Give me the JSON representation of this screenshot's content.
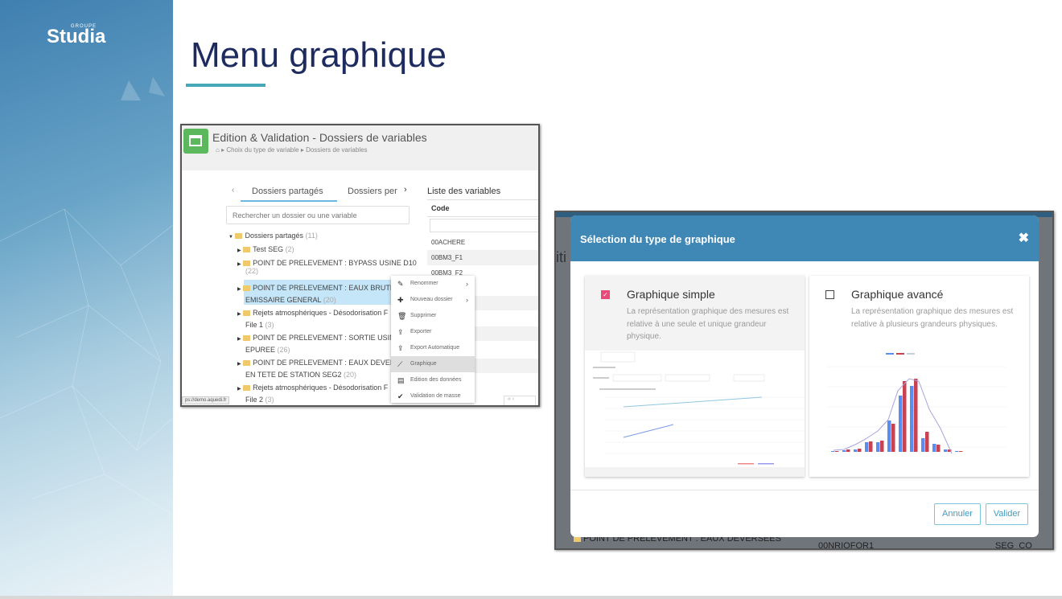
{
  "brand": {
    "group": "GROUPE",
    "name": "Studia"
  },
  "slide": {
    "title": "Menu graphique"
  },
  "left_shot": {
    "title": "Edition & Validation - Dossiers de variables",
    "breadcrumb": [
      "Choix du type de variable",
      "Dossiers de variables"
    ],
    "tabs": [
      "Dossiers partagés",
      "Dossiers per"
    ],
    "search_placeholder": "Rechercher un dossier ou une variable",
    "tree": [
      {
        "label": "Dossiers partagés",
        "count": "(11)"
      },
      {
        "label": "Test SEG",
        "count": "(2)"
      },
      {
        "label": "POINT DE PRELEVEMENT : BYPASS USINE D10",
        "count": "(22)"
      },
      {
        "label": "POINT DE PRELEVEMENT : EAUX BRUTES",
        "label2": "EMISSAIRE GENERAL",
        "count": "(20)"
      },
      {
        "label": "Rejets atmosphériques - Désodorisation F",
        "label2": "File 1",
        "count": "(3)"
      },
      {
        "label": "POINT DE PRELEVEMENT : SORTIE USINE I",
        "label2": "EPUREE",
        "count": "(26)"
      },
      {
        "label": "POINT DE PRELEVEMENT : EAUX DEVERSE",
        "label2": "EN TETE DE STATION SEG2",
        "count": "(20)"
      },
      {
        "label": "Rejets atmosphériques - Désodorisation F",
        "label2": "File 2",
        "count": "(3)"
      }
    ],
    "context_menu": [
      "Renommer",
      "Nouveau dossier",
      "Supprimer",
      "Exporter",
      "Export Automatique",
      "Graphique",
      "Edition des données",
      "Validation de masse"
    ],
    "variables_title": "Liste des variables",
    "code_header": "Code",
    "codes": [
      "00ACHERE",
      "00BM3_F1",
      "00BM3_F2"
    ],
    "status_url": "ps://demo.aquedi.fr"
  },
  "right_shot": {
    "bg_text": {
      "left": "iti",
      "folder": "POINT DE PRELEVEMENT : EAUX DEVERSEES",
      "code": "00NRIOFOR1",
      "site": "SEG_CO"
    },
    "modal_title": "Sélection du type de graphique",
    "options": [
      {
        "title": "Graphique simple",
        "desc": "La représentation graphique des mesures est relative à une seule et unique grandeur physique.",
        "checked": true
      },
      {
        "title": "Graphique avancé",
        "desc": "La représentation graphique des mesures est relative à plusieurs grandeurs physiques.",
        "checked": false
      }
    ],
    "cancel": "Annuler",
    "validate": "Valider",
    "colors": {
      "header": "#3f88b6",
      "check": "#e84a7a",
      "bar_blue": "#5b8def",
      "bar_red": "#c9424f"
    }
  }
}
